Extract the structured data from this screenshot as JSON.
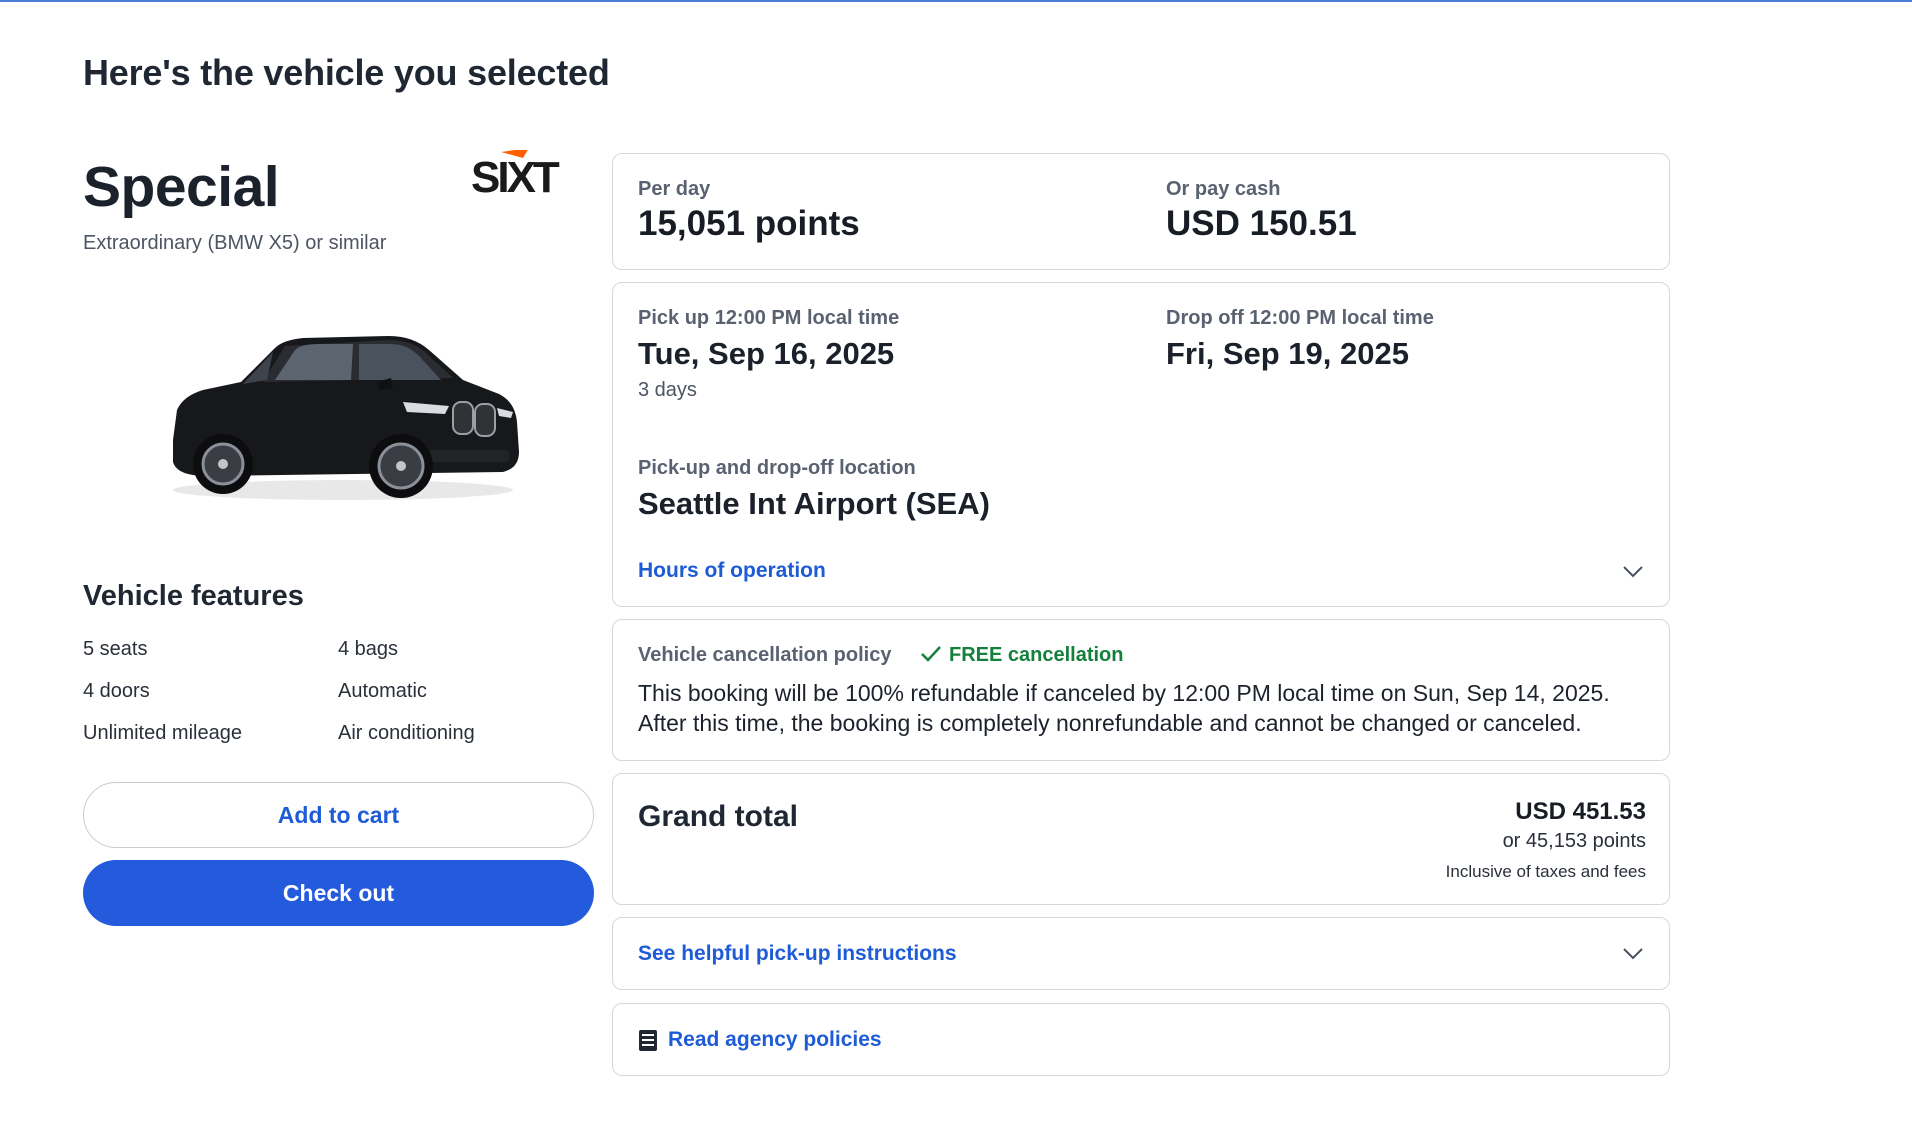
{
  "page": {
    "title": "Here's the vehicle you selected"
  },
  "vehicle": {
    "name": "Special",
    "subtitle": "Extraordinary (BMW X5) or similar",
    "brand": "SIXT",
    "features_title": "Vehicle features",
    "features": [
      "5 seats",
      "4 bags",
      "4 doors",
      "Automatic",
      "Unlimited mileage",
      "Air conditioning"
    ]
  },
  "actions": {
    "add_to_cart": "Add to cart",
    "check_out": "Check out"
  },
  "price": {
    "per_day_label": "Per day",
    "per_day_points": "15,051 points",
    "cash_label": "Or pay cash",
    "cash_value": "USD 150.51"
  },
  "trip": {
    "pickup_label": "Pick up 12:00 PM local time",
    "pickup_date": "Tue, Sep 16, 2025",
    "duration": "3 days",
    "dropoff_label": "Drop off 12:00 PM local time",
    "dropoff_date": "Fri, Sep 19, 2025",
    "location_label": "Pick-up and drop-off location",
    "location": "Seattle Int Airport (SEA)",
    "hours_link": "Hours of operation"
  },
  "cancellation": {
    "label": "Vehicle cancellation policy",
    "badge": "FREE cancellation",
    "line1": "This booking will be 100% refundable if canceled by 12:00 PM local time on Sun, Sep 14, 2025.",
    "line2": "After this time, the booking is completely nonrefundable and cannot be changed or canceled."
  },
  "total": {
    "label": "Grand total",
    "usd": "USD 451.53",
    "points": "or 45,153 points",
    "note": "Inclusive of taxes and fees"
  },
  "links": {
    "pickup_instructions": "See helpful pick-up instructions",
    "agency_policies": "Read agency policies"
  },
  "colors": {
    "accent": "#245bdd",
    "link": "#1e5bd6",
    "success": "#13803b",
    "border": "#d4d8de"
  }
}
